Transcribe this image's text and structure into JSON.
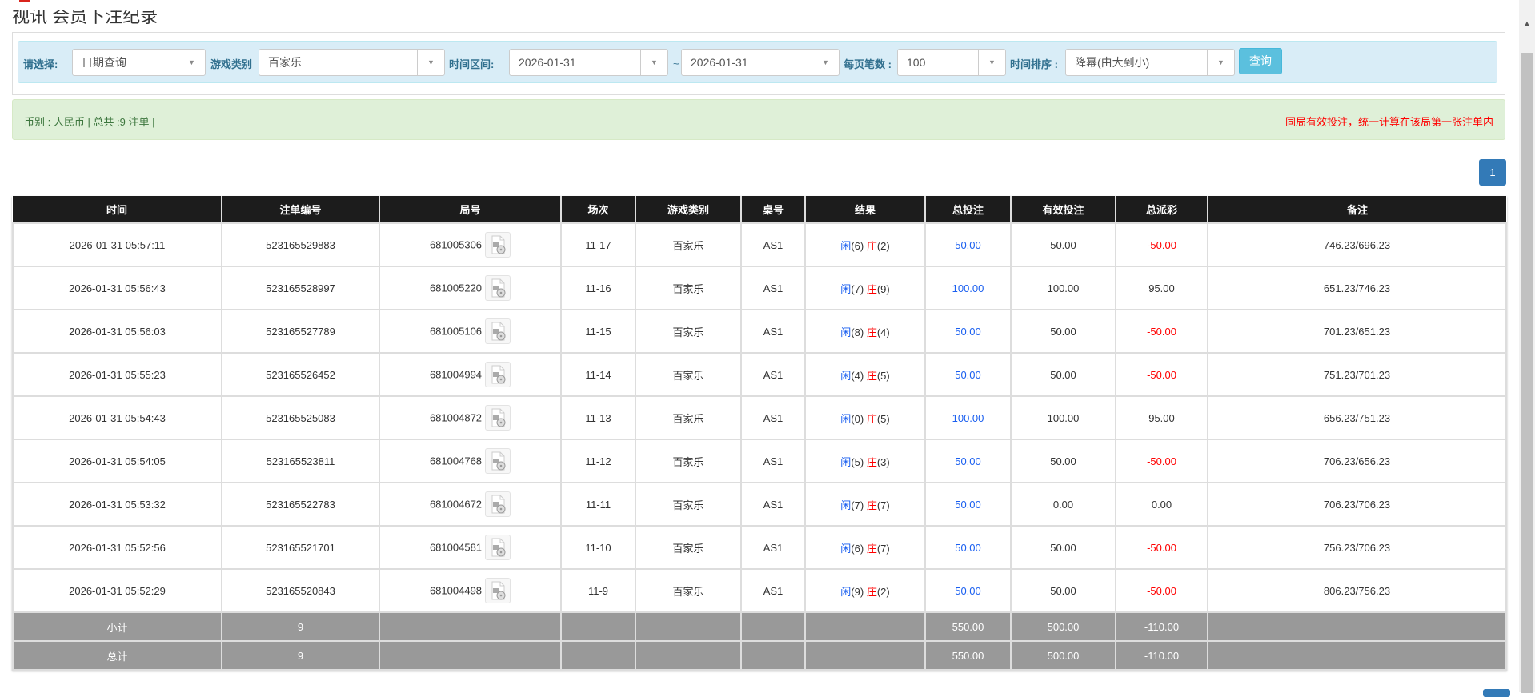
{
  "page_title": "视讯 会员下注纪录",
  "filters": {
    "select_label": "请选择:",
    "select_value": "日期查询",
    "game_type_label": "游戏类别",
    "game_type_value": "百家乐",
    "time_range_label": "时间区间:",
    "date_from": "2026-01-31",
    "range_sep": "~",
    "date_to": "2026-01-31",
    "per_page_label": "每页笔数 :",
    "per_page_value": "100",
    "sort_label": "时间排序 :",
    "sort_value": "降幂(由大到小)",
    "query_button": "查询"
  },
  "summary": {
    "left": "币别 : 人民币 | 总共 :9 注单 |",
    "right": "同局有效投注，统一计算在该局第一张注单内"
  },
  "pagination": {
    "current": "1"
  },
  "table": {
    "headers": [
      "时间",
      "注单编号",
      "局号",
      "场次",
      "游戏类别",
      "桌号",
      "结果",
      "总投注",
      "有效投注",
      "总派彩",
      "备注"
    ],
    "result_player": "闲",
    "result_banker": "庄",
    "rows": [
      {
        "time": "2026-01-31 05:57:11",
        "bet_id": "523165529883",
        "round": "681005306",
        "shoe": "11-17",
        "game": "百家乐",
        "table": "AS1",
        "player": "(6)",
        "banker": "(2)",
        "total_bet": "50.00",
        "valid_bet": "50.00",
        "payout": "-50.00",
        "payout_neg": true,
        "note": "746.23/696.23"
      },
      {
        "time": "2026-01-31 05:56:43",
        "bet_id": "523165528997",
        "round": "681005220",
        "shoe": "11-16",
        "game": "百家乐",
        "table": "AS1",
        "player": "(7)",
        "banker": "(9)",
        "total_bet": "100.00",
        "valid_bet": "100.00",
        "payout": "95.00",
        "payout_neg": false,
        "note": "651.23/746.23"
      },
      {
        "time": "2026-01-31 05:56:03",
        "bet_id": "523165527789",
        "round": "681005106",
        "shoe": "11-15",
        "game": "百家乐",
        "table": "AS1",
        "player": "(8)",
        "banker": "(4)",
        "total_bet": "50.00",
        "valid_bet": "50.00",
        "payout": "-50.00",
        "payout_neg": true,
        "note": "701.23/651.23"
      },
      {
        "time": "2026-01-31 05:55:23",
        "bet_id": "523165526452",
        "round": "681004994",
        "shoe": "11-14",
        "game": "百家乐",
        "table": "AS1",
        "player": "(4)",
        "banker": "(5)",
        "total_bet": "50.00",
        "valid_bet": "50.00",
        "payout": "-50.00",
        "payout_neg": true,
        "note": "751.23/701.23"
      },
      {
        "time": "2026-01-31 05:54:43",
        "bet_id": "523165525083",
        "round": "681004872",
        "shoe": "11-13",
        "game": "百家乐",
        "table": "AS1",
        "player": "(0)",
        "banker": "(5)",
        "total_bet": "100.00",
        "valid_bet": "100.00",
        "payout": "95.00",
        "payout_neg": false,
        "note": "656.23/751.23"
      },
      {
        "time": "2026-01-31 05:54:05",
        "bet_id": "523165523811",
        "round": "681004768",
        "shoe": "11-12",
        "game": "百家乐",
        "table": "AS1",
        "player": "(5)",
        "banker": "(3)",
        "total_bet": "50.00",
        "valid_bet": "50.00",
        "payout": "-50.00",
        "payout_neg": true,
        "note": "706.23/656.23"
      },
      {
        "time": "2026-01-31 05:53:32",
        "bet_id": "523165522783",
        "round": "681004672",
        "shoe": "11-11",
        "game": "百家乐",
        "table": "AS1",
        "player": "(7)",
        "banker": "(7)",
        "total_bet": "50.00",
        "valid_bet": "0.00",
        "payout": "0.00",
        "payout_neg": false,
        "note": "706.23/706.23"
      },
      {
        "time": "2026-01-31 05:52:56",
        "bet_id": "523165521701",
        "round": "681004581",
        "shoe": "11-10",
        "game": "百家乐",
        "table": "AS1",
        "player": "(6)",
        "banker": "(7)",
        "total_bet": "50.00",
        "valid_bet": "50.00",
        "payout": "-50.00",
        "payout_neg": true,
        "note": "756.23/706.23"
      },
      {
        "time": "2026-01-31 05:52:29",
        "bet_id": "523165520843",
        "round": "681004498",
        "shoe": "11-9",
        "game": "百家乐",
        "table": "AS1",
        "player": "(9)",
        "banker": "(2)",
        "total_bet": "50.00",
        "valid_bet": "50.00",
        "payout": "-50.00",
        "payout_neg": true,
        "note": "806.23/756.23"
      }
    ],
    "subtotal": {
      "label": "小计",
      "count": "9",
      "total_bet": "550.00",
      "valid_bet": "500.00",
      "payout": "-110.00"
    },
    "grand_total": {
      "label": "总计",
      "count": "9",
      "total_bet": "550.00",
      "valid_bet": "500.00",
      "payout": "-110.00"
    }
  },
  "colors": {
    "header_bg": "#1c1c1c",
    "filter_bg": "#d9edf7",
    "alert_bg": "#dff0d8",
    "button": "#5bc0de",
    "page_button": "#337ab7",
    "negative": "#ff0000",
    "player": "#1a5ff0"
  }
}
